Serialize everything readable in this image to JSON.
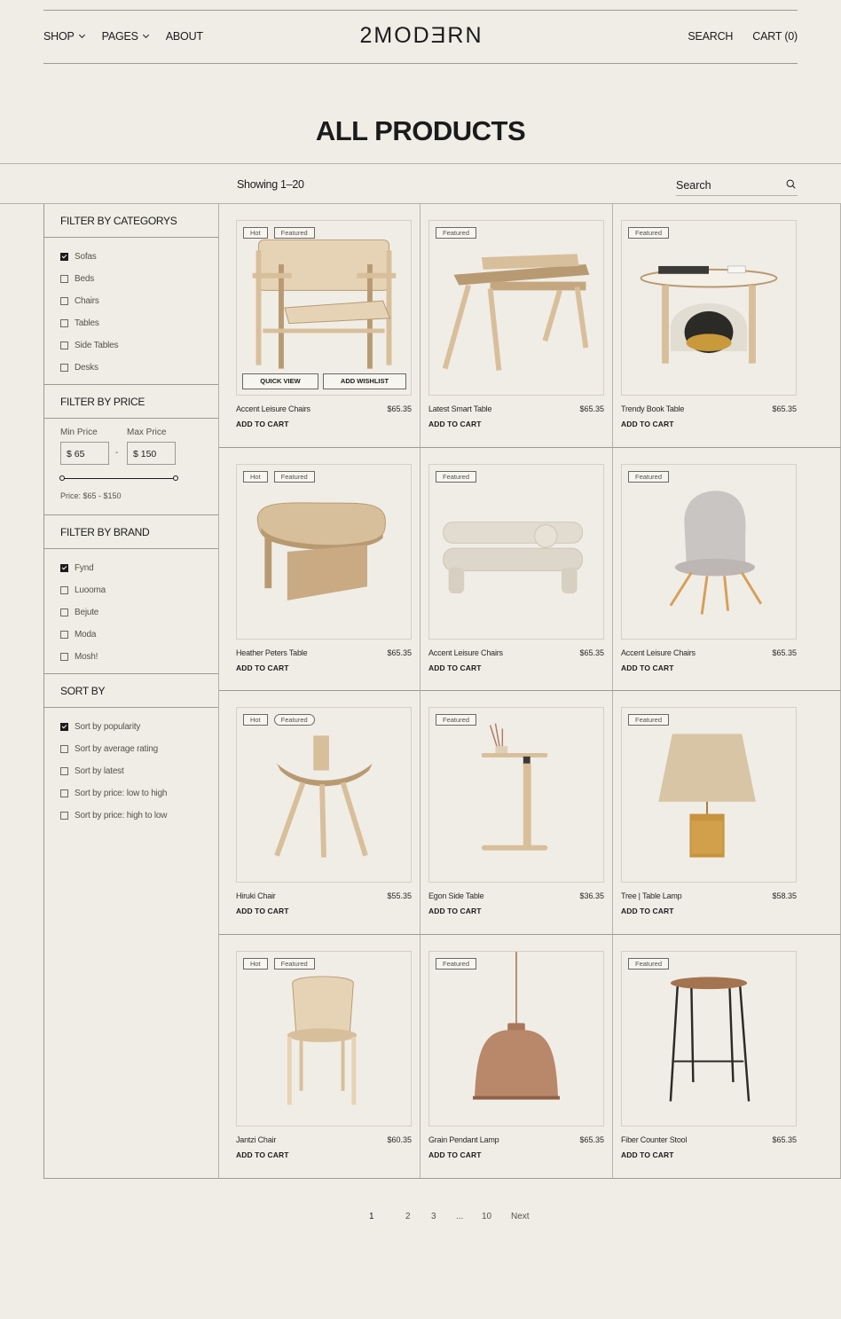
{
  "header": {
    "logo": "2MODƎRN",
    "nav_left": [
      {
        "label": "SHOP",
        "dropdown": true
      },
      {
        "label": "PAGES",
        "dropdown": true
      },
      {
        "label": "ABOUT",
        "dropdown": false
      }
    ],
    "search_label": "SEARCH",
    "cart_label": "CART (0)"
  },
  "page_title": "ALL PRODUCTS",
  "toolbar": {
    "showing": "Showing 1–20",
    "search_placeholder": "Search"
  },
  "filters": {
    "categories": {
      "title": "FILTER BY CATEGORYS",
      "items": [
        {
          "label": "Sofas",
          "checked": true
        },
        {
          "label": "Beds",
          "checked": false
        },
        {
          "label": "Chairs",
          "checked": false
        },
        {
          "label": "Tables",
          "checked": false
        },
        {
          "label": "Side Tables",
          "checked": false
        },
        {
          "label": "Desks",
          "checked": false
        }
      ]
    },
    "price": {
      "title": "FILTER BY PRICE",
      "min_label": "Min Price",
      "max_label": "Max Price",
      "min_value": "$ 65",
      "max_value": "$ 150",
      "separator": "-",
      "range_text": "Price: $65 - $150"
    },
    "brand": {
      "title": "FILTER BY BRAND",
      "items": [
        {
          "label": "Fynd",
          "checked": true
        },
        {
          "label": "Luooma",
          "checked": false
        },
        {
          "label": "Bejute",
          "checked": false
        },
        {
          "label": "Moda",
          "checked": false
        },
        {
          "label": "Mosh!",
          "checked": false
        }
      ]
    },
    "sort": {
      "title": "SORT BY",
      "items": [
        {
          "label": "Sort by popularity",
          "checked": true
        },
        {
          "label": "Sort by average rating",
          "checked": false
        },
        {
          "label": "Sort by latest",
          "checked": false
        },
        {
          "label": "Sort by price: low to high",
          "checked": false
        },
        {
          "label": "Sort by price: high to low",
          "checked": false
        }
      ]
    }
  },
  "products": [
    {
      "name": "Accent Leisure Chairs",
      "price": "$65.35",
      "badges": [
        "Hot",
        "Featured"
      ],
      "illustration": "armchair",
      "hover": true
    },
    {
      "name": "Latest Smart Table",
      "price": "$65.35",
      "badges": [
        "Featured"
      ],
      "illustration": "desk"
    },
    {
      "name": "Trendy Book Table",
      "price": "$65.35",
      "badges": [
        "Featured"
      ],
      "illustration": "round-table"
    },
    {
      "name": "Heather Peters Table",
      "price": "$65.35",
      "badges": [
        "Hot",
        "Featured"
      ],
      "illustration": "coffee-table"
    },
    {
      "name": "Accent Leisure Chairs",
      "price": "$65.35",
      "badges": [
        "Featured"
      ],
      "illustration": "bench"
    },
    {
      "name": "Accent Leisure Chairs",
      "price": "$65.35",
      "badges": [
        "Featured"
      ],
      "illustration": "grey-chair"
    },
    {
      "name": "Hiruki Chair",
      "price": "$55.35",
      "badges": [
        "Hot",
        "Featured"
      ],
      "round_badge": true,
      "illustration": "stool-chair"
    },
    {
      "name": "Egon Side Table",
      "price": "$36.35",
      "badges": [
        "Featured"
      ],
      "illustration": "side-table"
    },
    {
      "name": "Tree | Table Lamp",
      "price": "$58.35",
      "badges": [
        "Featured"
      ],
      "illustration": "table-lamp"
    },
    {
      "name": "Jantzi Chair",
      "price": "$60.35",
      "badges": [
        "Hot",
        "Featured"
      ],
      "illustration": "jantzi-chair"
    },
    {
      "name": "Grain Pendant Lamp",
      "price": "$65.35",
      "badges": [
        "Featured"
      ],
      "illustration": "pendant-lamp"
    },
    {
      "name": "Fiber Counter Stool",
      "price": "$65.35",
      "badges": [
        "Featured"
      ],
      "illustration": "counter-stool"
    }
  ],
  "product_actions": {
    "add_to_cart": "ADD TO CART",
    "quick_view": "QUICK VIEW",
    "add_wishlist": "ADD WISHLIST"
  },
  "pagination": {
    "pages": [
      "1",
      "2",
      "3",
      "...",
      "10"
    ],
    "next": "Next"
  },
  "colors": {
    "background": "#f0ede6",
    "text": "#1b1b1b",
    "wood": "#d8bf9b",
    "border": "#9d9a94"
  }
}
